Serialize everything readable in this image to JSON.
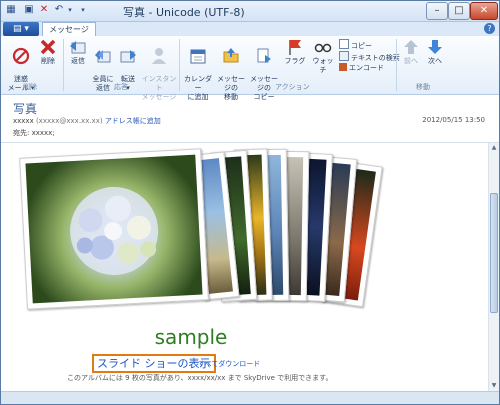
{
  "window": {
    "title": "写真 - Unicode (UTF-8)"
  },
  "window_controls": {
    "minimize": "–",
    "maximize": "□",
    "close": "✕"
  },
  "tabs": {
    "active": "メッセージ"
  },
  "ribbon": {
    "delete_group": {
      "junk": "迷惑\nメール ▾",
      "delete": "削除",
      "label": "削除"
    },
    "reply_group": {
      "reply": "返信",
      "reply_all": "全員に\n返信",
      "forward": "転送\n▾",
      "im": "インスタント\nメッセージ",
      "label": "応答"
    },
    "actions_group": {
      "add_calendar": "カレンダー\nに追加",
      "move": "メッセージの\n移動",
      "copy_msg": "メッセージの\nコピー",
      "flag": "フラグ",
      "watch": "ウォッチ",
      "copy": "コピー",
      "find_text": "テキストの検索",
      "encoding": "エンコード",
      "label": "アクション"
    },
    "move_group": {
      "prev": "前へ",
      "next": "次へ",
      "label": "移動"
    }
  },
  "message": {
    "subject": "写真",
    "from_name": "xxxxx",
    "from_email": "(xxxxx@xxx.xx.xx)",
    "add_contact": "アドレス帳に追加",
    "date": "2012/05/15 13:50",
    "to": "宛先: xxxxx;"
  },
  "album": {
    "title": "sample",
    "slideshow": "スライド ショーの表示",
    "download_all": "すべてダウンロード",
    "note": "このアルバムには 9 枚の写真があり、xxxx/xx/xx まで SkyDrive で利用できます。"
  },
  "icons": [
    "save-icon",
    "delete-icon",
    "reply-icon",
    "chevron-down-icon",
    "help-icon",
    "junk-icon",
    "forward-icon",
    "calendar-icon",
    "folder-icon",
    "flag-icon",
    "glasses-icon",
    "up-arrow-icon",
    "down-arrow-icon"
  ],
  "colors": {
    "accent": "#1c4f9c",
    "link": "#1a56c8",
    "highlight": "#e07a12",
    "album_title": "#2e7d23"
  }
}
